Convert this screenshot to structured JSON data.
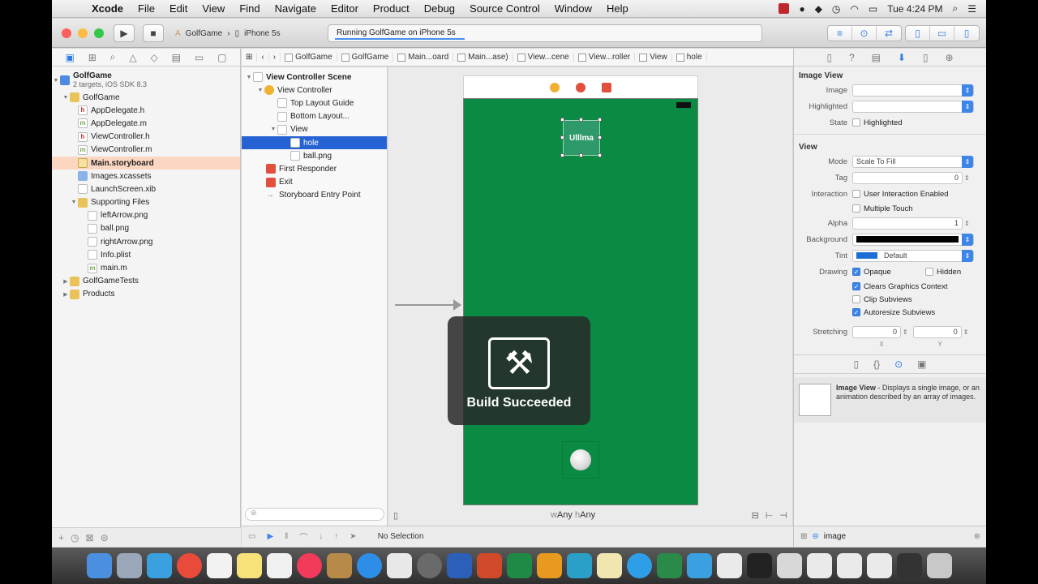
{
  "menubar": {
    "app": "Xcode",
    "items": [
      "File",
      "Edit",
      "View",
      "Find",
      "Navigate",
      "Editor",
      "Product",
      "Debug",
      "Source Control",
      "Window",
      "Help"
    ],
    "clock": "Tue 4:24 PM"
  },
  "toolbar": {
    "scheme": "GolfGame",
    "device": "iPhone 5s",
    "activity": "Running GolfGame on iPhone 5s"
  },
  "navigator": {
    "project": "GolfGame",
    "project_sub": "2 targets, iOS SDK 8.3",
    "items": [
      "GolfGame",
      "AppDelegate.h",
      "AppDelegate.m",
      "ViewController.h",
      "ViewController.m",
      "Main.storyboard",
      "Images.xcassets",
      "LaunchScreen.xib",
      "Supporting Files",
      "leftArrow.png",
      "ball.png",
      "rightArrow.png",
      "Info.plist",
      "main.m",
      "GolfGameTests",
      "Products"
    ]
  },
  "jumpbar": {
    "crumbs": [
      "GolfGame",
      "GolfGame",
      "Main...oard",
      "Main...ase)",
      "View...cene",
      "View...roller",
      "View",
      "hole"
    ]
  },
  "outline": {
    "items": [
      "View Controller Scene",
      "View Controller",
      "Top Layout Guide",
      "Bottom Layout...",
      "View",
      "hole",
      "ball.png",
      "First Responder",
      "Exit",
      "Storyboard Entry Point"
    ]
  },
  "canvas": {
    "hole_label": "Ulllma",
    "hud_message": "Build Succeeded",
    "size_w": "Any",
    "size_h": "Any",
    "colors": {
      "background": "#0a8a42"
    }
  },
  "debugbar": {
    "status": "No Selection"
  },
  "inspector": {
    "image_view_title": "Image View",
    "image_label": "Image",
    "highlighted_label": "Highlighted",
    "state_label": "State",
    "state_value": "Highlighted",
    "view_title": "View",
    "mode_label": "Mode",
    "mode_value": "Scale To Fill",
    "tag_label": "Tag",
    "tag_value": "0",
    "interaction_label": "Interaction",
    "user_interaction": "User Interaction Enabled",
    "multiple_touch": "Multiple Touch",
    "alpha_label": "Alpha",
    "alpha_value": "1",
    "background_label": "Background",
    "tint_label": "Tint",
    "tint_value": "Default",
    "drawing_label": "Drawing",
    "opaque": "Opaque",
    "hidden": "Hidden",
    "clears": "Clears Graphics Context",
    "clip": "Clip Subviews",
    "autoresize": "Autoresize Subviews",
    "stretching_label": "Stretching",
    "stretch_x": "0",
    "stretch_y": "0",
    "x_label": "X",
    "y_label": "Y",
    "library_title": "Image View",
    "library_desc": "- Displays a single image, or an animation described by an array of images.",
    "filter_value": "image"
  }
}
